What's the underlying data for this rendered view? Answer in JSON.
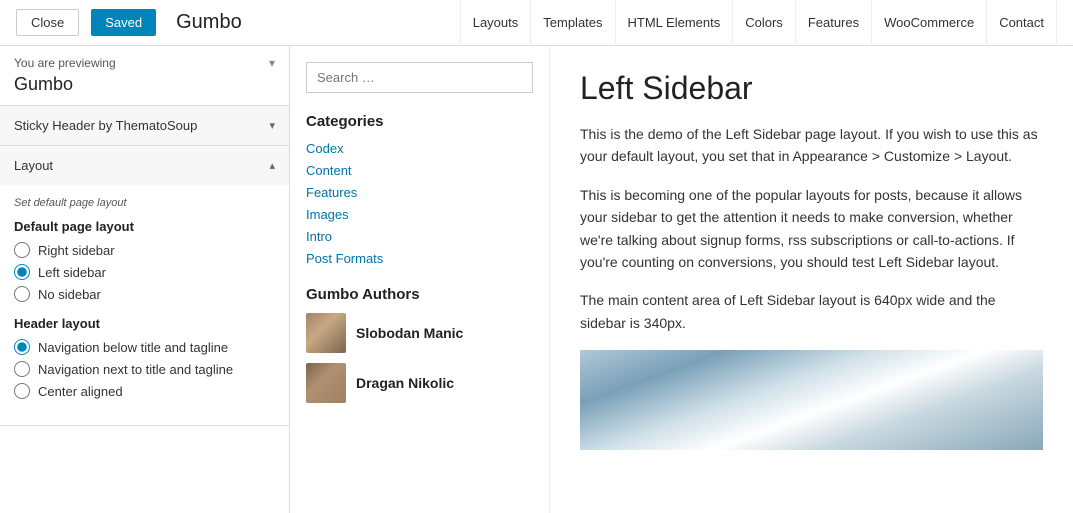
{
  "topbar": {
    "close_label": "Close",
    "saved_label": "Saved",
    "site_title": "Gumbo",
    "nav_items": [
      {
        "label": "Layouts",
        "id": "layouts"
      },
      {
        "label": "Templates",
        "id": "templates"
      },
      {
        "label": "HTML Elements",
        "id": "html-elements"
      },
      {
        "label": "Colors",
        "id": "colors"
      },
      {
        "label": "Features",
        "id": "features"
      },
      {
        "label": "WooCommerce",
        "id": "woocommerce"
      },
      {
        "label": "Contact",
        "id": "contact"
      }
    ]
  },
  "left_panel": {
    "preview_notice": "You are previewing",
    "preview_site": "Gumbo",
    "sticky_header_label": "Sticky Header by ThematoSoup",
    "layout_label": "Layout",
    "set_default_label": "Set default page layout",
    "default_layout_label": "Default page layout",
    "layout_options": [
      {
        "id": "right-sidebar",
        "label": "Right sidebar",
        "checked": false
      },
      {
        "id": "left-sidebar",
        "label": "Left sidebar",
        "checked": true
      },
      {
        "id": "no-sidebar",
        "label": "No sidebar",
        "checked": false
      }
    ],
    "header_layout_label": "Header layout",
    "header_options": [
      {
        "id": "nav-below",
        "label": "Navigation below title and tagline",
        "checked": true
      },
      {
        "id": "nav-next",
        "label": "Navigation next to title and tagline",
        "checked": false
      },
      {
        "id": "center-aligned",
        "label": "Center aligned",
        "checked": false
      }
    ]
  },
  "sidebar": {
    "search_placeholder": "Search …",
    "categories_title": "Categories",
    "categories": [
      {
        "label": "Codex"
      },
      {
        "label": "Content"
      },
      {
        "label": "Features"
      },
      {
        "label": "Images"
      },
      {
        "label": "Intro"
      },
      {
        "label": "Post Formats"
      }
    ],
    "authors_title": "Gumbo Authors",
    "authors": [
      {
        "name": "Slobodan Manic"
      },
      {
        "name": "Dragan Nikolic"
      }
    ]
  },
  "article": {
    "title": "Left Sidebar",
    "paragraphs": [
      "This is the demo of the Left Sidebar page layout. If you wish to use this as your default layout, you set that in Appearance > Customize > Layout.",
      "This is becoming one of the popular layouts for posts, because it allows your sidebar to get the attention it needs to make conversion, whether we're talking about signup forms, rss subscriptions or call-to-actions. If you're counting on conversions, you should test Left Sidebar layout.",
      "The main content area of Left Sidebar layout is 640px wide and the sidebar is 340px."
    ]
  }
}
